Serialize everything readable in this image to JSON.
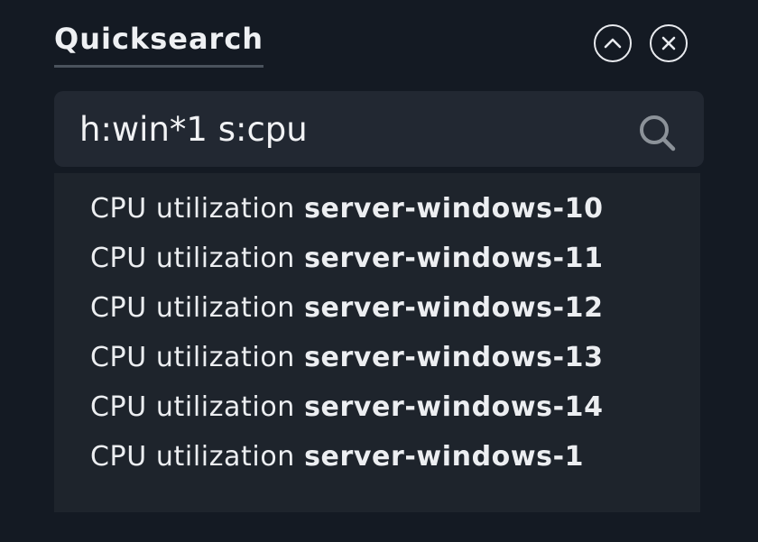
{
  "header": {
    "title": "Quicksearch",
    "collapse_icon": "chevron-up-icon",
    "close_icon": "close-icon"
  },
  "search": {
    "value": "h:win*1 s:cpu",
    "icon": "search-icon"
  },
  "results": [
    {
      "service": "CPU utilization",
      "host": "server-windows-10"
    },
    {
      "service": "CPU utilization",
      "host": "server-windows-11"
    },
    {
      "service": "CPU utilization",
      "host": "server-windows-12"
    },
    {
      "service": "CPU utilization",
      "host": "server-windows-13"
    },
    {
      "service": "CPU utilization",
      "host": "server-windows-14"
    },
    {
      "service": "CPU utilization",
      "host": "server-windows-1"
    }
  ],
  "colors": {
    "background": "#141a23",
    "search_box": "#222832",
    "results_panel": "#1e242c",
    "text": "#eceef1"
  }
}
